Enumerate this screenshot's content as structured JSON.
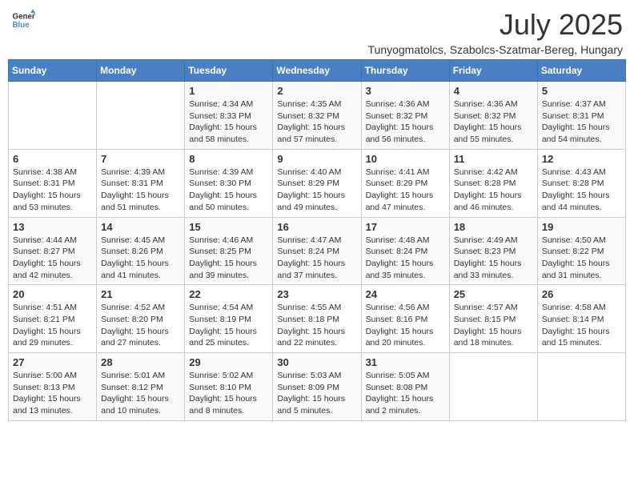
{
  "logo": {
    "text_general": "General",
    "text_blue": "Blue"
  },
  "header": {
    "month": "July 2025",
    "subtitle": "Tunyogmatolcs, Szabolcs-Szatmar-Bereg, Hungary"
  },
  "weekdays": [
    "Sunday",
    "Monday",
    "Tuesday",
    "Wednesday",
    "Thursday",
    "Friday",
    "Saturday"
  ],
  "weeks": [
    [
      {
        "day": "",
        "detail": ""
      },
      {
        "day": "",
        "detail": ""
      },
      {
        "day": "1",
        "detail": "Sunrise: 4:34 AM\nSunset: 8:33 PM\nDaylight: 15 hours and 58 minutes."
      },
      {
        "day": "2",
        "detail": "Sunrise: 4:35 AM\nSunset: 8:32 PM\nDaylight: 15 hours and 57 minutes."
      },
      {
        "day": "3",
        "detail": "Sunrise: 4:36 AM\nSunset: 8:32 PM\nDaylight: 15 hours and 56 minutes."
      },
      {
        "day": "4",
        "detail": "Sunrise: 4:36 AM\nSunset: 8:32 PM\nDaylight: 15 hours and 55 minutes."
      },
      {
        "day": "5",
        "detail": "Sunrise: 4:37 AM\nSunset: 8:31 PM\nDaylight: 15 hours and 54 minutes."
      }
    ],
    [
      {
        "day": "6",
        "detail": "Sunrise: 4:38 AM\nSunset: 8:31 PM\nDaylight: 15 hours and 53 minutes."
      },
      {
        "day": "7",
        "detail": "Sunrise: 4:39 AM\nSunset: 8:31 PM\nDaylight: 15 hours and 51 minutes."
      },
      {
        "day": "8",
        "detail": "Sunrise: 4:39 AM\nSunset: 8:30 PM\nDaylight: 15 hours and 50 minutes."
      },
      {
        "day": "9",
        "detail": "Sunrise: 4:40 AM\nSunset: 8:29 PM\nDaylight: 15 hours and 49 minutes."
      },
      {
        "day": "10",
        "detail": "Sunrise: 4:41 AM\nSunset: 8:29 PM\nDaylight: 15 hours and 47 minutes."
      },
      {
        "day": "11",
        "detail": "Sunrise: 4:42 AM\nSunset: 8:28 PM\nDaylight: 15 hours and 46 minutes."
      },
      {
        "day": "12",
        "detail": "Sunrise: 4:43 AM\nSunset: 8:28 PM\nDaylight: 15 hours and 44 minutes."
      }
    ],
    [
      {
        "day": "13",
        "detail": "Sunrise: 4:44 AM\nSunset: 8:27 PM\nDaylight: 15 hours and 42 minutes."
      },
      {
        "day": "14",
        "detail": "Sunrise: 4:45 AM\nSunset: 8:26 PM\nDaylight: 15 hours and 41 minutes."
      },
      {
        "day": "15",
        "detail": "Sunrise: 4:46 AM\nSunset: 8:25 PM\nDaylight: 15 hours and 39 minutes."
      },
      {
        "day": "16",
        "detail": "Sunrise: 4:47 AM\nSunset: 8:24 PM\nDaylight: 15 hours and 37 minutes."
      },
      {
        "day": "17",
        "detail": "Sunrise: 4:48 AM\nSunset: 8:24 PM\nDaylight: 15 hours and 35 minutes."
      },
      {
        "day": "18",
        "detail": "Sunrise: 4:49 AM\nSunset: 8:23 PM\nDaylight: 15 hours and 33 minutes."
      },
      {
        "day": "19",
        "detail": "Sunrise: 4:50 AM\nSunset: 8:22 PM\nDaylight: 15 hours and 31 minutes."
      }
    ],
    [
      {
        "day": "20",
        "detail": "Sunrise: 4:51 AM\nSunset: 8:21 PM\nDaylight: 15 hours and 29 minutes."
      },
      {
        "day": "21",
        "detail": "Sunrise: 4:52 AM\nSunset: 8:20 PM\nDaylight: 15 hours and 27 minutes."
      },
      {
        "day": "22",
        "detail": "Sunrise: 4:54 AM\nSunset: 8:19 PM\nDaylight: 15 hours and 25 minutes."
      },
      {
        "day": "23",
        "detail": "Sunrise: 4:55 AM\nSunset: 8:18 PM\nDaylight: 15 hours and 22 minutes."
      },
      {
        "day": "24",
        "detail": "Sunrise: 4:56 AM\nSunset: 8:16 PM\nDaylight: 15 hours and 20 minutes."
      },
      {
        "day": "25",
        "detail": "Sunrise: 4:57 AM\nSunset: 8:15 PM\nDaylight: 15 hours and 18 minutes."
      },
      {
        "day": "26",
        "detail": "Sunrise: 4:58 AM\nSunset: 8:14 PM\nDaylight: 15 hours and 15 minutes."
      }
    ],
    [
      {
        "day": "27",
        "detail": "Sunrise: 5:00 AM\nSunset: 8:13 PM\nDaylight: 15 hours and 13 minutes."
      },
      {
        "day": "28",
        "detail": "Sunrise: 5:01 AM\nSunset: 8:12 PM\nDaylight: 15 hours and 10 minutes."
      },
      {
        "day": "29",
        "detail": "Sunrise: 5:02 AM\nSunset: 8:10 PM\nDaylight: 15 hours and 8 minutes."
      },
      {
        "day": "30",
        "detail": "Sunrise: 5:03 AM\nSunset: 8:09 PM\nDaylight: 15 hours and 5 minutes."
      },
      {
        "day": "31",
        "detail": "Sunrise: 5:05 AM\nSunset: 8:08 PM\nDaylight: 15 hours and 2 minutes."
      },
      {
        "day": "",
        "detail": ""
      },
      {
        "day": "",
        "detail": ""
      }
    ]
  ]
}
